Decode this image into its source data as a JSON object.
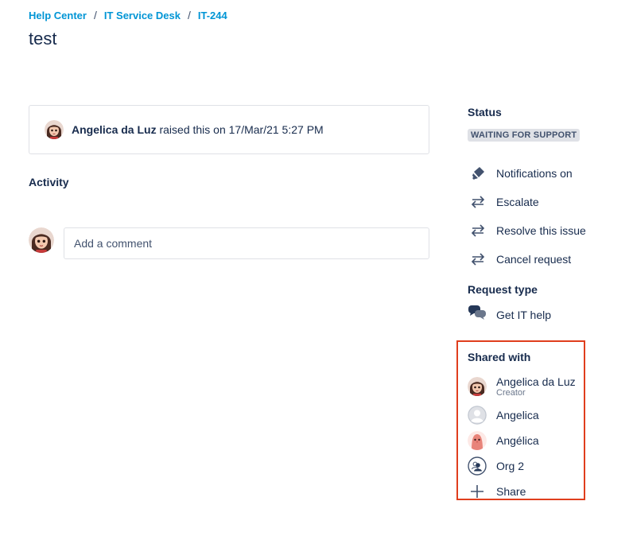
{
  "breadcrumb": {
    "items": [
      "Help Center",
      "IT Service Desk",
      "IT-244"
    ],
    "separator": "/"
  },
  "page": {
    "title": "test"
  },
  "raised": {
    "user": "Angelica da Luz",
    "text": "raised this on 17/Mar/21 5:27 PM"
  },
  "activity": {
    "heading": "Activity",
    "comment_placeholder": "Add a comment"
  },
  "sidebar": {
    "status_heading": "Status",
    "status_value": "WAITING FOR SUPPORT",
    "actions": [
      {
        "label": "Notifications on",
        "icon": "bell-icon"
      },
      {
        "label": "Escalate",
        "icon": "transition-icon"
      },
      {
        "label": "Resolve this issue",
        "icon": "transition-icon"
      },
      {
        "label": "Cancel request",
        "icon": "transition-icon"
      }
    ],
    "request_type_heading": "Request type",
    "request_type": "Get IT help",
    "shared_heading": "Shared with",
    "shared": [
      {
        "name": "Angelica da Luz",
        "role": "Creator"
      },
      {
        "name": "Angelica"
      },
      {
        "name": "Angélica"
      },
      {
        "name": "Org 2"
      },
      {
        "name": "Share"
      }
    ]
  },
  "colors": {
    "link": "#0095d5",
    "text": "#172b4d",
    "highlight_border": "#e03e1d",
    "lozenge_bg": "#dfe1e6"
  }
}
